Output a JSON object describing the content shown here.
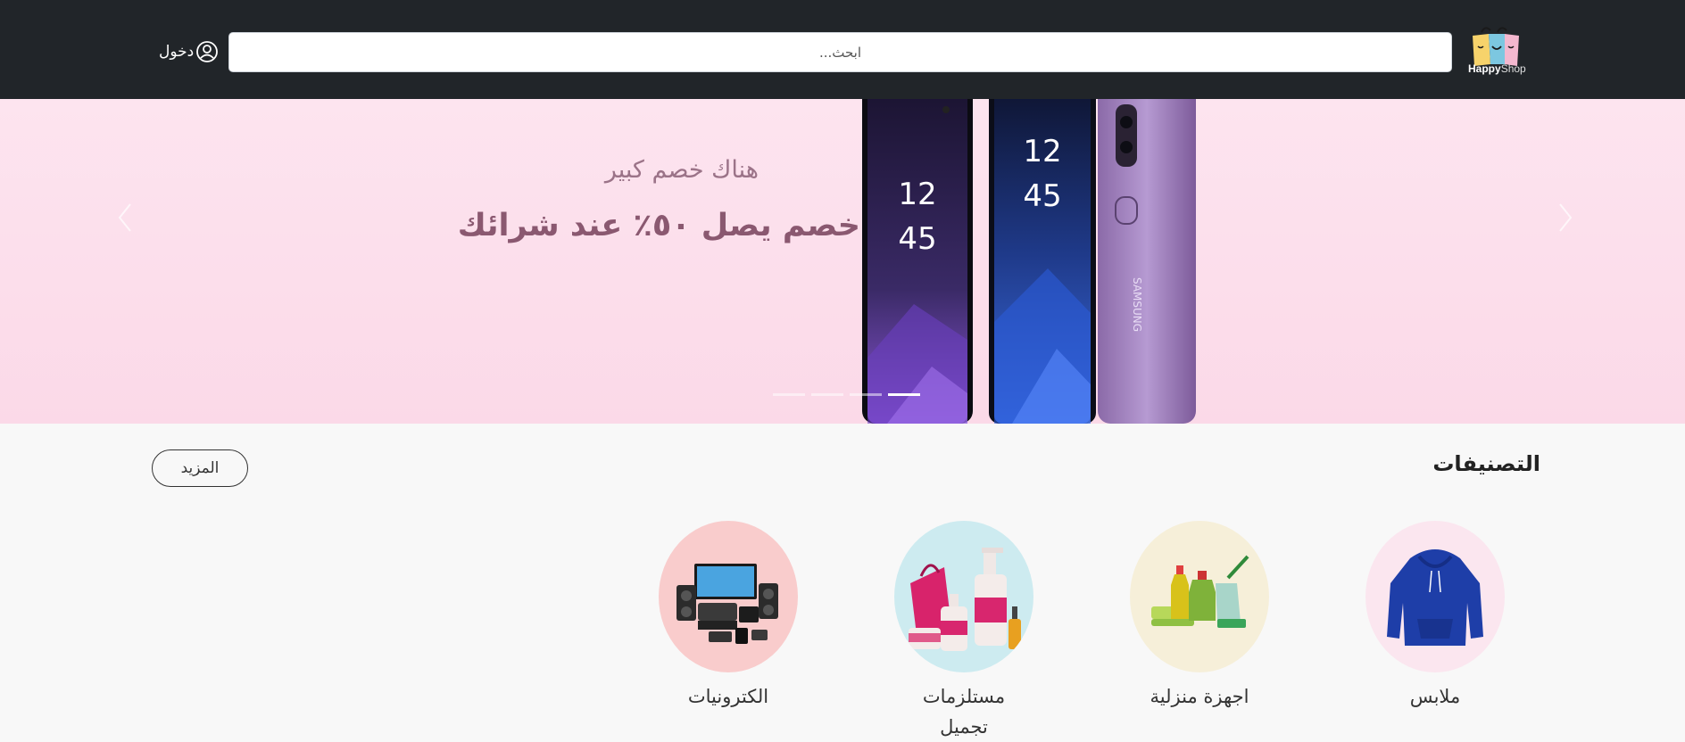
{
  "header": {
    "logo": {
      "word1": "Happy",
      "word2": "Shop",
      "icon": "shopping-bag-logo-icon"
    },
    "search": {
      "placeholder": "ابحث..."
    },
    "login": {
      "label": "دخول",
      "icon": "user-circle-icon"
    }
  },
  "hero": {
    "subtitle": "هناك خصم كبير",
    "title": "خصم يصل ٥٠٪ عند شرائك",
    "slide_count": 4,
    "active_slide": 4,
    "prev_icon": "chevron-left-icon",
    "next_icon": "chevron-right-icon"
  },
  "categories": {
    "heading": "التصنيفات",
    "more_label": "المزيد",
    "items": [
      {
        "label": "ملابس",
        "color": "#fbe6ef",
        "icon": "hoodie-icon"
      },
      {
        "label": "اجهزة منزلية",
        "color": "#f6efd9",
        "icon": "cleaning-supplies-icon"
      },
      {
        "label": "مستلزمات تجميل",
        "color": "#cdebf0",
        "icon": "cosmetics-icon"
      },
      {
        "label": "الكترونيات",
        "color": "#f9cccc",
        "icon": "electronics-icon"
      }
    ]
  },
  "colors": {
    "header_bg": "#212529",
    "hero_bg": "#fde4ef",
    "hero_title": "#8a5870",
    "page_bg": "#f8f8f8"
  }
}
